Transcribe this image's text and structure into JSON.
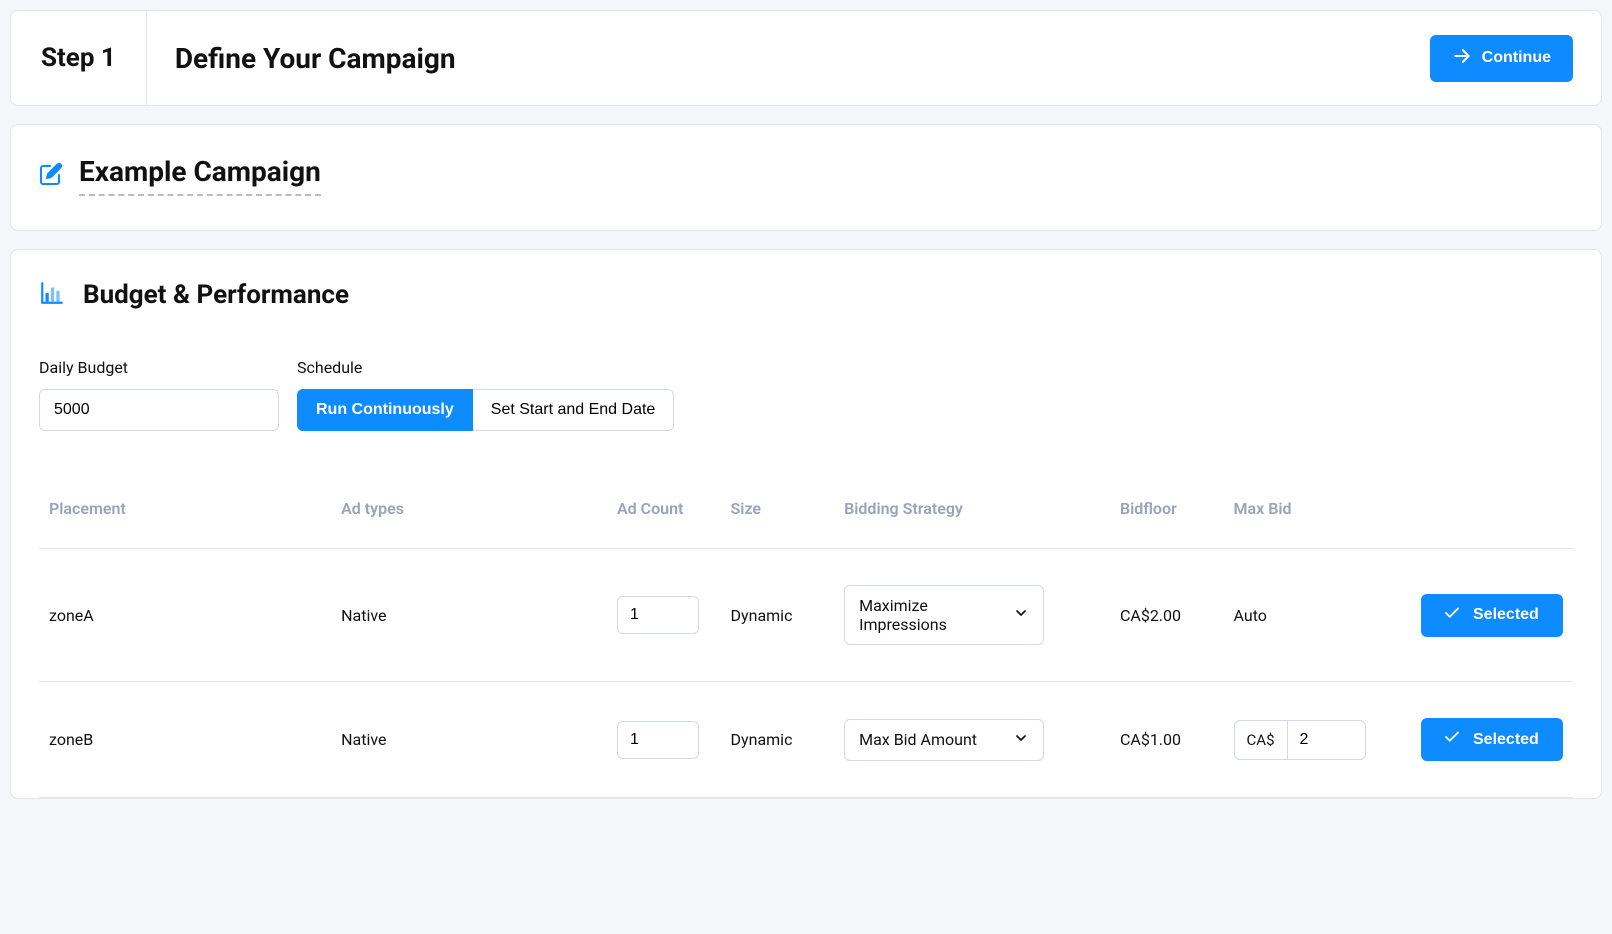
{
  "header": {
    "step_label": "Step 1",
    "title": "Define Your Campaign",
    "continue_label": "Continue"
  },
  "campaign": {
    "name": "Example Campaign"
  },
  "budget_section": {
    "title": "Budget & Performance",
    "daily_budget_label": "Daily Budget",
    "daily_budget_value": "5000",
    "schedule_label": "Schedule",
    "schedule_options": {
      "continuous": "Run Continuously",
      "dated": "Set Start and End Date"
    }
  },
  "table": {
    "headers": {
      "placement": "Placement",
      "ad_types": "Ad types",
      "ad_count": "Ad Count",
      "size": "Size",
      "bidding_strategy": "Bidding Strategy",
      "bidfloor": "Bidfloor",
      "max_bid": "Max Bid"
    },
    "rows": [
      {
        "placement": "zoneA",
        "ad_types": "Native",
        "ad_count": "1",
        "size": "Dynamic",
        "bidding_strategy": "Maximize Impressions",
        "bidfloor": "CA$2.00",
        "max_bid_type": "auto",
        "max_bid_auto_label": "Auto",
        "selected_label": "Selected"
      },
      {
        "placement": "zoneB",
        "ad_types": "Native",
        "ad_count": "1",
        "size": "Dynamic",
        "bidding_strategy": "Max Bid Amount",
        "bidfloor": "CA$1.00",
        "max_bid_type": "input",
        "max_bid_prefix": "CA$",
        "max_bid_value": "2",
        "selected_label": "Selected"
      }
    ]
  }
}
